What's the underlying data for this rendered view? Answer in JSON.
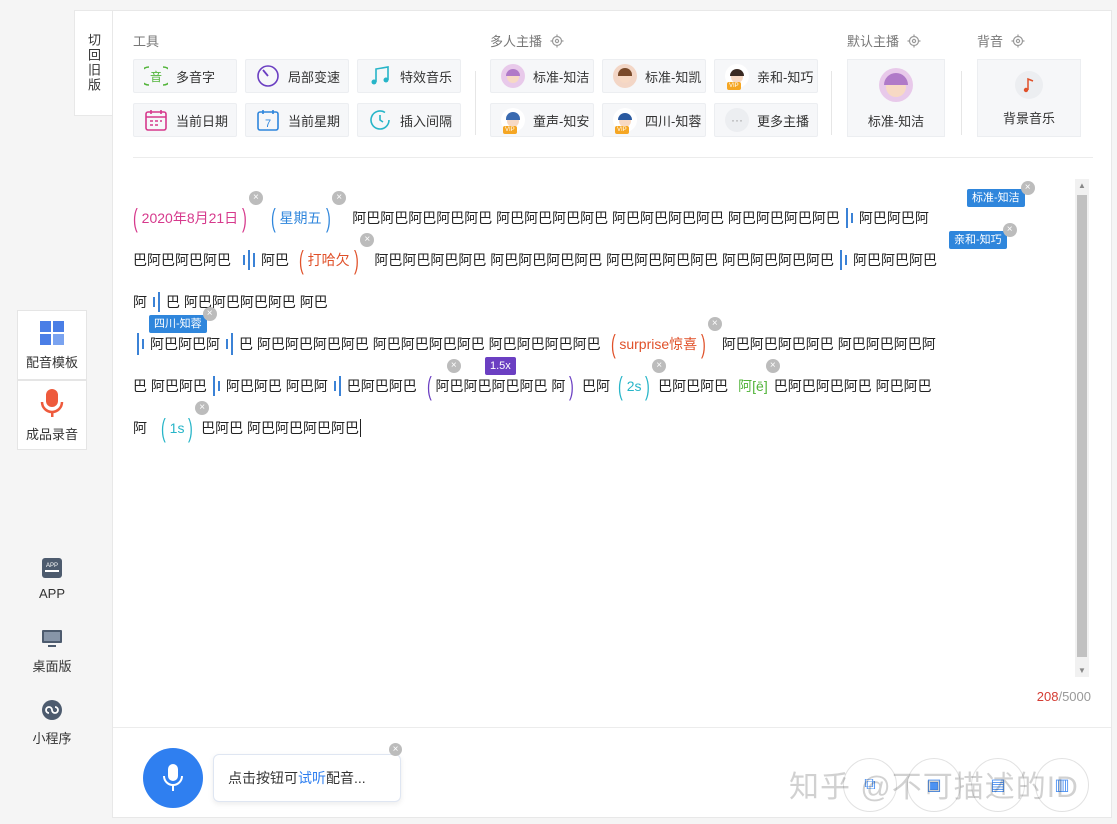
{
  "sidebar": {
    "switch_old": "切回旧版",
    "items": [
      {
        "label": "配音模板",
        "icon": "grid-icon"
      },
      {
        "label": "成品录音",
        "icon": "mic-icon"
      }
    ],
    "bottom": [
      {
        "label": "APP",
        "icon": "app-icon"
      },
      {
        "label": "桌面版",
        "icon": "desktop-icon"
      },
      {
        "label": "小程序",
        "icon": "mini-program-icon"
      }
    ]
  },
  "toolbar": {
    "tools_title": "工具",
    "tools": [
      {
        "label": "多音字",
        "icon": "polyphone-icon"
      },
      {
        "label": "局部变速",
        "icon": "speed-dial-icon"
      },
      {
        "label": "特效音乐",
        "icon": "music-note-icon"
      },
      {
        "label": "当前日期",
        "icon": "calendar-icon"
      },
      {
        "label": "当前星期",
        "icon": "weekday-icon"
      },
      {
        "label": "插入间隔",
        "icon": "clock-icon"
      }
    ],
    "multi_title": "多人主播",
    "anchors": [
      {
        "label": "标准-知洁"
      },
      {
        "label": "标准-知凯"
      },
      {
        "label": "亲和-知巧"
      },
      {
        "label": "童声-知安"
      },
      {
        "label": "四川-知蓉"
      },
      {
        "label": "更多主播"
      }
    ],
    "default_title": "默认主播",
    "default_anchor": "标准-知洁",
    "bgm_title": "背音",
    "bgm_label": "背景音乐"
  },
  "editor": {
    "lines": {
      "l1": {
        "date_tag": "2020年8月21日",
        "week_tag": "星期五",
        "text": "阿巴阿巴阿巴阿巴阿巴 阿巴阿巴阿巴阿巴 阿巴阿巴阿巴阿巴 阿巴阿巴阿巴阿巴",
        "text2": "阿巴阿巴阿",
        "speaker": "标准-知洁"
      },
      "l2": {
        "text1": "巴阿巴阿巴阿巴",
        "text2": "阿巴",
        "effect_tag": "打哈欠",
        "text3": "阿巴阿巴阿巴阿巴 阿巴阿巴阿巴阿巴 阿巴阿巴阿巴阿巴 阿巴阿巴阿巴阿巴",
        "text4": "阿巴阿巴阿巴",
        "speaker": "亲和-知巧"
      },
      "l3": {
        "text1": "阿",
        "text2": "巴 阿巴阿巴阿巴阿巴 阿巴"
      },
      "l4": {
        "speaker": "四川-知蓉",
        "text1": "阿巴阿巴阿",
        "text2": "巴 阿巴阿巴阿巴阿巴 阿巴阿巴阿巴阿巴 阿巴阿巴阿巴阿巴",
        "effect_tag": "surprise惊喜",
        "text3": "阿巴阿巴阿巴阿巴 阿巴阿巴阿巴阿"
      },
      "l5": {
        "text1": "巴 阿巴阿巴",
        "text2": "阿巴阿巴 阿巴阿",
        "text3": "巴阿巴阿巴",
        "speed_label": "1.5x",
        "speed_tag": "阿巴阿巴阿巴阿巴 阿",
        "text4": "巴阿",
        "pause_tag": "2s",
        "text5": "巴阿巴阿巴",
        "poly_tag": "阿[ē]",
        "text6": "巴阿巴阿巴阿巴 阿巴阿巴"
      },
      "l6": {
        "text1": "阿",
        "pause_tag": "1s",
        "text2": "巴阿巴 阿巴阿巴阿巴阿巴"
      }
    },
    "count": "208",
    "max": "/5000"
  },
  "footer": {
    "tip_prefix": "点击按钮可",
    "tip_link": "试听",
    "tip_suffix": "配音...",
    "watermark": "知乎 @不可描述的ID"
  },
  "colors": {
    "accent": "#2f7ff0",
    "date_tag": "#d6398c",
    "week_tag": "#2f86dc",
    "effect_tag": "#e0512a",
    "speed_tag": "#6b3fc2",
    "pause_tag": "#27b5c8",
    "poly_tag": "#52b43a",
    "counter": "#d43c33"
  }
}
